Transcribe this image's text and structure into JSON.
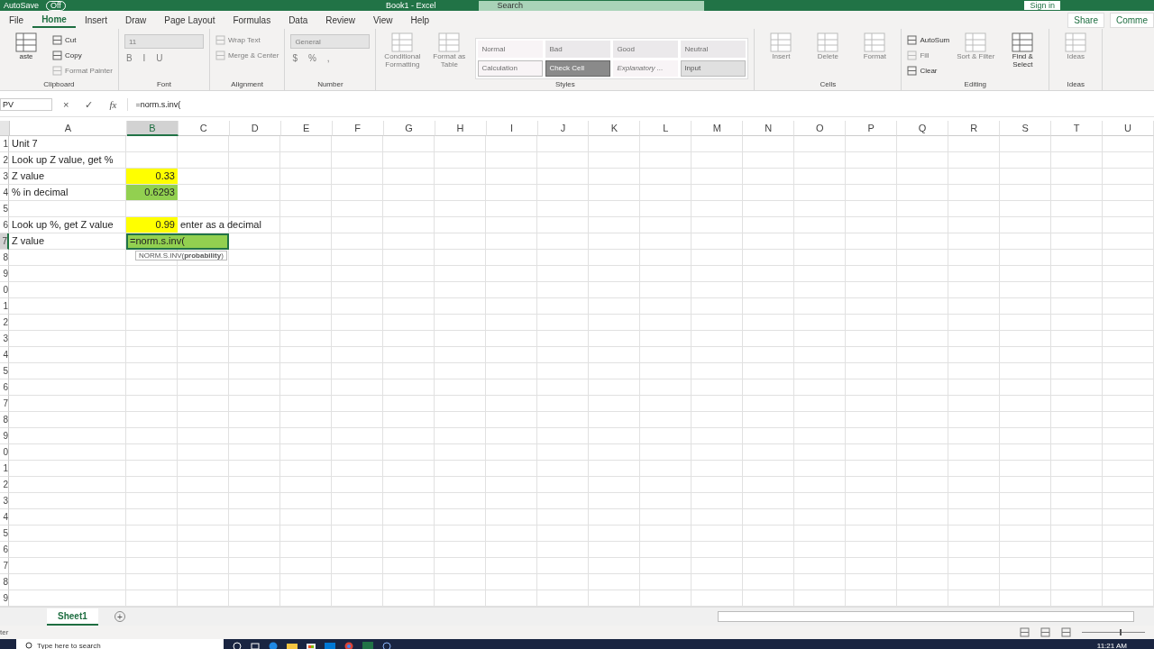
{
  "title_bar": {
    "autosave": "AutoSave",
    "toggle": "Off",
    "title": "Book1 - Excel",
    "search": "Search",
    "sign_in": "Sign in"
  },
  "ribbon_tabs": [
    {
      "label": "File",
      "selected": false
    },
    {
      "label": "Home",
      "selected": true
    },
    {
      "label": "Insert",
      "selected": false
    },
    {
      "label": "Draw",
      "selected": false
    },
    {
      "label": "Page Layout",
      "selected": false
    },
    {
      "label": "Formulas",
      "selected": false
    },
    {
      "label": "Data",
      "selected": false
    },
    {
      "label": "Review",
      "selected": false
    },
    {
      "label": "View",
      "selected": false
    },
    {
      "label": "Help",
      "selected": false
    }
  ],
  "ribbon_actions": [
    "Share",
    "Comme"
  ],
  "ribbon_groups": [
    {
      "label": "Clipboard",
      "items": [
        {
          "kind": "large",
          "label": "aste",
          "disabled": false
        },
        {
          "kind": "small",
          "label": "Cut",
          "disabled": false
        },
        {
          "kind": "small",
          "label": "Copy",
          "disabled": false
        },
        {
          "kind": "small",
          "label": "Format Painter",
          "disabled": true
        }
      ]
    },
    {
      "label": "Font",
      "items": [
        {
          "kind": "combo",
          "label": "11",
          "disabled": true
        },
        {
          "kind": "glyphs",
          "glyphs": [
            "B",
            "I",
            "U"
          ],
          "disabled": true
        }
      ]
    },
    {
      "label": "Alignment",
      "items": [
        {
          "kind": "small",
          "label": "Wrap Text",
          "disabled": true
        },
        {
          "kind": "small",
          "label": "Merge & Center",
          "disabled": true
        }
      ]
    },
    {
      "label": "Number",
      "items": [
        {
          "kind": "combo",
          "label": "General",
          "disabled": true
        },
        {
          "kind": "glyphs",
          "glyphs": [
            "$",
            "%",
            ","
          ],
          "disabled": true
        }
      ]
    },
    {
      "label": "Styles",
      "items": [
        {
          "kind": "large",
          "label": "Conditional Formatting",
          "disabled": true
        },
        {
          "kind": "large",
          "label": "Format as Table",
          "disabled": true
        },
        {
          "kind": "gallery",
          "cells": [
            {
              "label": "Normal",
              "kind": "normal"
            },
            {
              "label": "Bad",
              "kind": "bad"
            },
            {
              "label": "Good",
              "kind": "good"
            },
            {
              "label": "Neutral",
              "kind": "neutral"
            },
            {
              "label": "Calculation",
              "kind": "calculation"
            },
            {
              "label": "Check Cell",
              "kind": "check"
            },
            {
              "label": "Explanatory ...",
              "kind": "explanatory"
            },
            {
              "label": "Input",
              "kind": "input"
            }
          ]
        }
      ]
    },
    {
      "label": "Cells",
      "items": [
        {
          "kind": "large",
          "label": "Insert",
          "disabled": true
        },
        {
          "kind": "large",
          "label": "Delete",
          "disabled": true
        },
        {
          "kind": "large",
          "label": "Format",
          "disabled": true
        }
      ]
    },
    {
      "label": "Editing",
      "items": [
        {
          "kind": "small",
          "label": "AutoSum",
          "disabled": false
        },
        {
          "kind": "small",
          "label": "Fill",
          "disabled": true
        },
        {
          "kind": "small",
          "label": "Clear",
          "disabled": false
        },
        {
          "kind": "large",
          "label": "Sort & Filter",
          "disabled": true
        },
        {
          "kind": "large",
          "label": "Find & Select",
          "disabled": false
        }
      ]
    },
    {
      "label": "Ideas",
      "items": [
        {
          "kind": "large",
          "label": "Ideas",
          "disabled": true
        }
      ]
    }
  ],
  "formula_bar": {
    "name_box": "PV",
    "cancel": "×",
    "enter": "✓",
    "fx": "fx",
    "formula": "=norm.s.inv("
  },
  "columns": [
    {
      "label": "A",
      "selected": false
    },
    {
      "label": "B",
      "selected": true
    },
    {
      "label": "C",
      "selected": false
    },
    {
      "label": "D",
      "selected": false
    },
    {
      "label": "E",
      "selected": false
    },
    {
      "label": "F",
      "selected": false
    },
    {
      "label": "G",
      "selected": false
    },
    {
      "label": "H",
      "selected": false
    },
    {
      "label": "I",
      "selected": false
    },
    {
      "label": "J",
      "selected": false
    },
    {
      "label": "K",
      "selected": false
    },
    {
      "label": "L",
      "selected": false
    },
    {
      "label": "M",
      "selected": false
    },
    {
      "label": "N",
      "selected": false
    },
    {
      "label": "O",
      "selected": false
    },
    {
      "label": "P",
      "selected": false
    },
    {
      "label": "Q",
      "selected": false
    },
    {
      "label": "R",
      "selected": false
    },
    {
      "label": "S",
      "selected": false
    },
    {
      "label": "T",
      "selected": false
    },
    {
      "label": "U",
      "selected": false
    }
  ],
  "rows": [
    {
      "label": "1",
      "selected": false,
      "cells": [
        {
          "text": "Unit 7",
          "kind": "text"
        }
      ]
    },
    {
      "label": "2",
      "selected": false,
      "cells": [
        {
          "text": "Look up Z value, get %",
          "kind": "text"
        }
      ]
    },
    {
      "label": "3",
      "selected": false,
      "cells": [
        {
          "text": "Z value",
          "kind": "text"
        },
        {
          "text": "0.33",
          "kind": "number",
          "color": "#ffff00"
        }
      ]
    },
    {
      "label": "4",
      "selected": false,
      "cells": [
        {
          "text": "% in decimal",
          "kind": "text"
        },
        {
          "text": "0.6293",
          "kind": "number",
          "color": "#92d050"
        }
      ]
    },
    {
      "label": "5",
      "selected": false
    },
    {
      "label": "6",
      "selected": false,
      "cells": [
        {
          "text": "Look up %, get Z value",
          "kind": "text"
        },
        {
          "text": "0.99",
          "kind": "number",
          "color": "#ffff00"
        },
        {
          "text": "enter as a decimal",
          "kind": "text"
        }
      ]
    },
    {
      "label": "7",
      "selected": true,
      "cells": [
        {
          "text": "Z value",
          "kind": "text"
        },
        {
          "text": "=norm.s.inv(",
          "kind": "text",
          "color": "#92d050",
          "editing": true
        }
      ]
    },
    {
      "label": "8",
      "selected": false
    },
    {
      "label": "9",
      "selected": false
    },
    {
      "label": "0",
      "selected": false
    },
    {
      "label": "1",
      "selected": false
    },
    {
      "label": "2",
      "selected": false
    },
    {
      "label": "3",
      "selected": false
    },
    {
      "label": "4",
      "selected": false
    },
    {
      "label": "5",
      "selected": false
    },
    {
      "label": "6",
      "selected": false
    },
    {
      "label": "7",
      "selected": false
    },
    {
      "label": "8",
      "selected": false
    },
    {
      "label": "9",
      "selected": false
    },
    {
      "label": "0",
      "selected": false
    },
    {
      "label": "1",
      "selected": false
    },
    {
      "label": "2",
      "selected": false
    },
    {
      "label": "3",
      "selected": false
    },
    {
      "label": "4",
      "selected": false
    },
    {
      "label": "5",
      "selected": false
    },
    {
      "label": "6",
      "selected": false
    },
    {
      "label": "7",
      "selected": false
    },
    {
      "label": "8",
      "selected": false
    },
    {
      "label": "9",
      "selected": false
    }
  ],
  "tooltip": "NORM.S.INV(**probability**)",
  "sheet_tabs": [
    {
      "label": "Sheet1",
      "selected": true
    }
  ],
  "add_sheet": "+",
  "status_bar": {
    "mode": "ter",
    "zoom": {
      "level": 0.6
    }
  },
  "taskbar": {
    "search_placeholder": "Type here to search",
    "clock": "11:21 AM"
  }
}
